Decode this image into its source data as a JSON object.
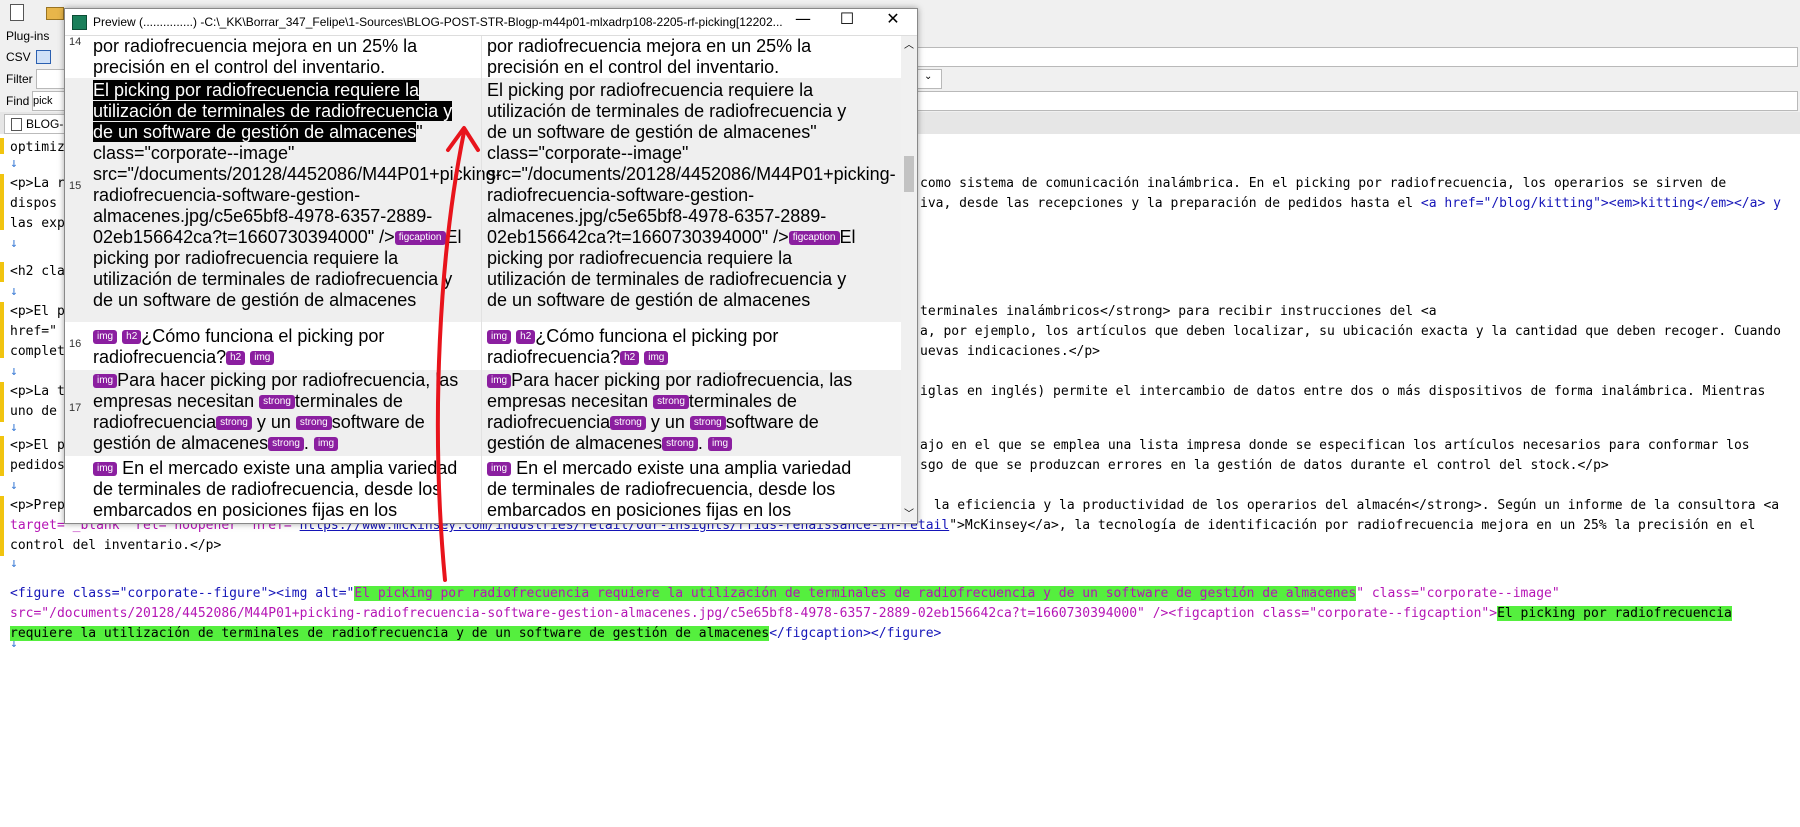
{
  "main": {
    "plugins_label": "Plug-ins",
    "csv_label": "CSV",
    "filter_label": "Filter",
    "find_label": "Find",
    "find_value": "pick",
    "tab_label": "BLOG-F",
    "code_lines": [
      "optimiz",
      "<p>La r",
      "dispos",
      "las exp",
      "<h2 cla",
      "<p>El p",
      "href=\"",
      "complet",
      "<p>La t",
      "uno de",
      "<p>El p",
      "pedidos",
      "<p>Prep"
    ],
    "right_fragments": {
      "l1a": "como sistema de comunicación inalámbrica. En el picking por radiofrecuencia, los operarios se sirven de",
      "l1b": "iva, desde las recepciones y la preparación de pedidos hasta el ",
      "l1b_link": "<a href=\"/blog/kitting\"><em>kitting</em></a> y",
      "l2a": "terminales inalámbricos</strong> para recibir instrucciones del <a",
      "l2b": "a, por ejemplo, los artículos que deben localizar, su ubicación exacta y la cantidad que deben recoger. Cuando",
      "l2c": "uevas indicaciones.</p>",
      "l3a": "iglas en inglés) permite el intercambio de datos entre dos o más dispositivos de forma inalámbrica. Mientras",
      "l4a": "ajo en el que se emplea una lista impresa donde se especifican los artículos necesarios para conformar los",
      "l4b": "sgo de que se produzcan errores en la gestión de datos durante el control del stock.</p>",
      "l5a": " la eficiencia y la productividad de los operarios del almacén</strong>. Según un informe de la consultora <a",
      "l5b": "target=\"_blank\" rel=\"noopener\" href=\"",
      "l5b_url": "https://www.mckinsey.com/industries/retail/our-insights/rfids-renaissance-in-retail",
      "l5b_tail": "\">McKinsey</a>, la tecnología de identificación por radiofrecuencia mejora en un 25% la precisión en el",
      "l5c": "control del inventario.</p>"
    },
    "figure_line1_pre": "<figure class=\"corporate--figure\"><img alt=\"",
    "figure_alt": "El picking por radiofrecuencia requiere la utilización de terminales de radiofrecuencia y de un software de gestión de almacenes",
    "figure_line1_post": "\" class=\"corporate--image\"",
    "figure_line2_src": "src=\"/documents/20128/4452086/M44P01+picking-radiofrecuencia-software-gestion-almacenes.jpg/c5e65bf8-4978-6357-2889-02eb156642ca?t=1660730394000\" /><figcaption class=\"corporate--figcaption\">",
    "figure_caption_a": "El picking por radiofrecuencia",
    "figure_caption_b": "requiere la utilización de terminales de radiofrecuencia y de un software de gestión de almacenes",
    "figure_line3_post": "</figcaption></figure>"
  },
  "preview": {
    "title": "Preview (...............) -C:\\_KK\\Borrar_347_Felipe\\1-Sources\\BLOG-POST-STR-Blogp-m44p01-mlxadrp108-2205-rf-picking[12202...",
    "minimize": "—",
    "maximize": "☐",
    "close": "✕",
    "rows": [
      {
        "num": "14",
        "left": "por radiofrecuencia mejora en un 25% la precisión en el control del inventario.",
        "right": "por radiofrecuencia mejora en un 25% la precisión en el control del inventario."
      },
      {
        "num": "15",
        "left_sel": "El picking por radiofrecuencia requiere la utilización de terminales de radiofrecuencia y de un software de gestión de almacenes",
        "left_rest": "\" class=\"corporate--image\" src=\"/documents/20128/4452086/M44P01+picking-radiofrecuencia-software-gestion-almacenes.jpg/c5e65bf8-4978-6357-2889-02eb156642ca?t=1660730394000\" />",
        "left_cap": "El picking por radiofrecuencia requiere la utilización de terminales de radiofrecuencia y de un software de gestión de almacenes",
        "right_a": "El picking por radiofrecuencia requiere la utilización de terminales de radiofrecuencia y de un software de gestión de almacenes\" class=\"corporate--image\" src=\"/documents/20128/4452086/M44P01+picking-radiofrecuencia-software-gestion-almacenes.jpg/c5e65bf8-4978-6357-2889-02eb156642ca?t=1660730394000\" />",
        "right_cap": "El picking por radiofrecuencia requiere la utilización de terminales de radiofrecuencia y de un software de gestión de almacenes"
      },
      {
        "num": "16",
        "text": "¿Cómo funciona el picking por radiofrecuencia?"
      },
      {
        "num": "17",
        "a": "Para hacer picking por radiofrecuencia, las empresas necesitan ",
        "b": "terminales de radiofrecuencia",
        "c": " y un ",
        "d": "software de gestión de almacenes",
        "e": "."
      },
      {
        "num": "",
        "text": " En el mercado existe una amplia variedad de terminales de radiofrecuencia, desde los embarcados en posiciones fijas en los"
      }
    ],
    "badges": {
      "img": "img",
      "h2": "h2",
      "strong": "strong",
      "figcaption": "figcaption"
    }
  },
  "colors": {
    "highlight": "#55ef3e",
    "annotation_arrow": "#e8141c",
    "badge": "#8b1fa0"
  }
}
